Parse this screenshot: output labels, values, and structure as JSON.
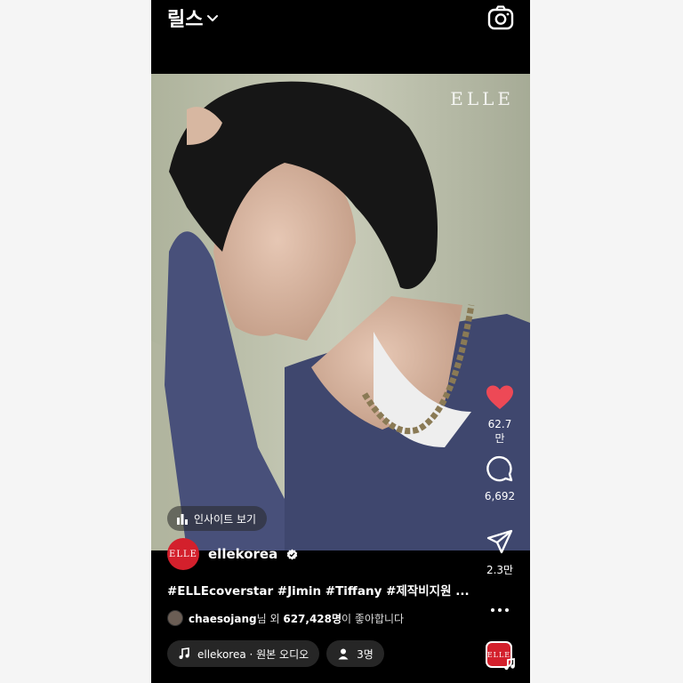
{
  "header": {
    "title": "릴스",
    "camera_icon": "camera-icon",
    "dropdown_icon": "chevron-down-icon"
  },
  "video": {
    "watermark": "ELLE"
  },
  "insight": {
    "label": "인사이트 보기",
    "icon": "bar-chart-icon"
  },
  "actions": {
    "like": {
      "icon": "heart-icon",
      "count": "62.7만",
      "color": "#ed4956"
    },
    "comment": {
      "icon": "comment-icon",
      "count": "6,692"
    },
    "share": {
      "icon": "send-icon",
      "count": "2.3만"
    },
    "more": {
      "icon": "more-icon"
    }
  },
  "post": {
    "avatar_text": "ELLE",
    "username": "ellekorea",
    "verified_icon": "verified-badge-icon",
    "caption": "#ELLEcoverstar #Jimin #Tiffany #제작비지원 ..."
  },
  "likes": {
    "liker": "chaesojang",
    "text_before": "님 외 ",
    "count": "627,428명",
    "text_after": "이 좋아합니다"
  },
  "chips": {
    "audio": {
      "icon": "music-note-icon",
      "label": "ellekorea · 원본 오디오"
    },
    "people": {
      "icon": "person-icon",
      "label": "3명"
    }
  },
  "audio_thumb": {
    "text": "ELLE",
    "icon": "music-note-icon"
  }
}
